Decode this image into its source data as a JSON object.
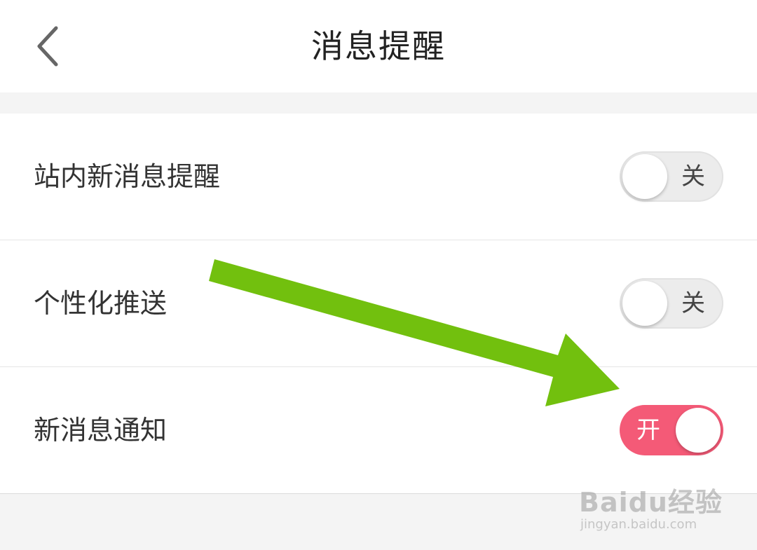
{
  "header": {
    "title": "消息提醒",
    "back_icon": "chevron-left-icon"
  },
  "settings": [
    {
      "label": "站内新消息提醒",
      "state": "关",
      "enabled": false
    },
    {
      "label": "个性化推送",
      "state": "关",
      "enabled": false
    },
    {
      "label": "新消息通知",
      "state": "开",
      "enabled": true
    }
  ],
  "annotation": {
    "icon": "arrow-icon",
    "color": "#72c00e"
  },
  "colors": {
    "toggle_on": "#f45a77",
    "toggle_off": "#ececec"
  },
  "watermark": {
    "brand": "Baidu经验",
    "url": "jingyan.baidu.com"
  }
}
